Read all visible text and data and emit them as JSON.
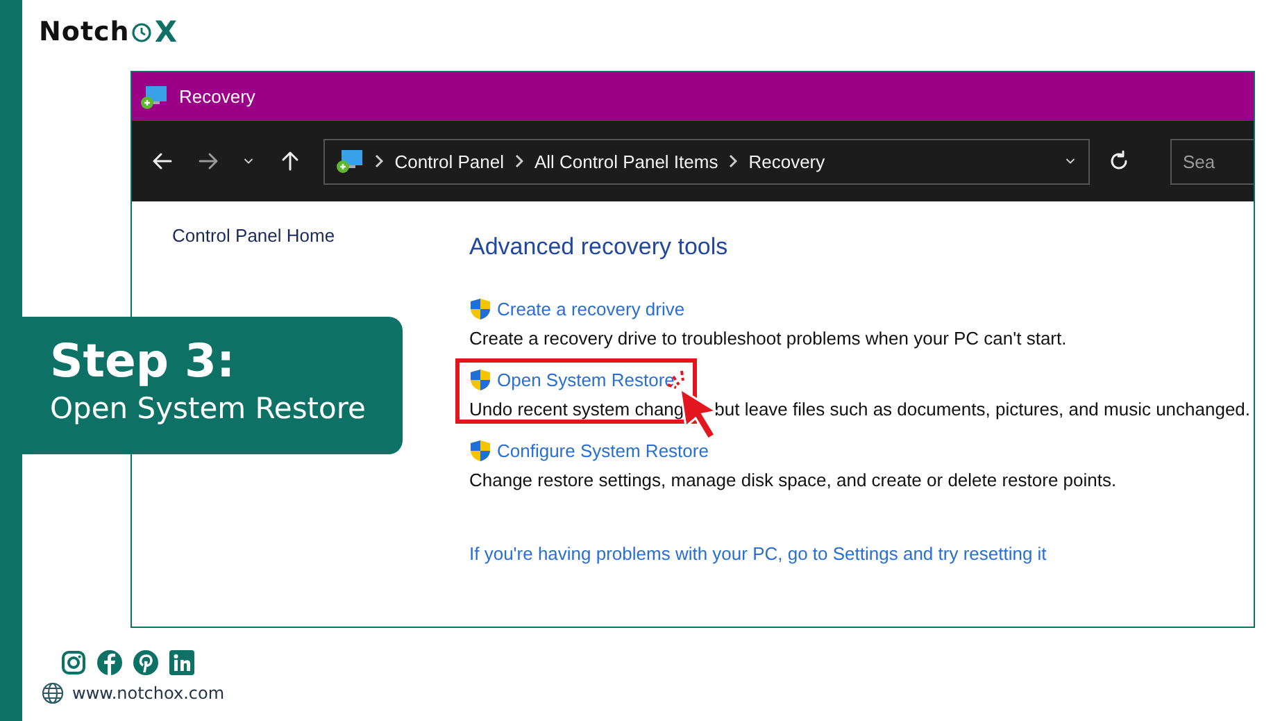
{
  "logo": {
    "prefix": "Notch",
    "suffix": "X"
  },
  "window": {
    "title": "Recovery",
    "breadcrumb": [
      "Control Panel",
      "All Control Panel Items",
      "Recovery"
    ],
    "search": {
      "placeholder": "Sea"
    }
  },
  "sidebar": {
    "items": [
      "Control Panel Home"
    ]
  },
  "main": {
    "heading": "Advanced recovery tools",
    "tools": [
      {
        "link": "Create a recovery drive",
        "description": [
          "Create a recovery drive to troubleshoot problems when your PC can't start."
        ],
        "highlighted": false
      },
      {
        "link": "Open System Restore",
        "description": [
          "Undo recent system chang",
          "but leave files such as documents, pictures, and music unchanged."
        ],
        "highlighted": true
      },
      {
        "link": "Configure System Restore",
        "description": [
          "Change restore settings, manage disk space, and create or delete restore points."
        ],
        "highlighted": false
      }
    ],
    "footer_link": "If you're having problems with your PC, go to Settings and try resetting it"
  },
  "step": {
    "title": "Step 3:",
    "subtitle": "Open System Restore"
  },
  "footer": {
    "website": "www.notchox.com"
  }
}
